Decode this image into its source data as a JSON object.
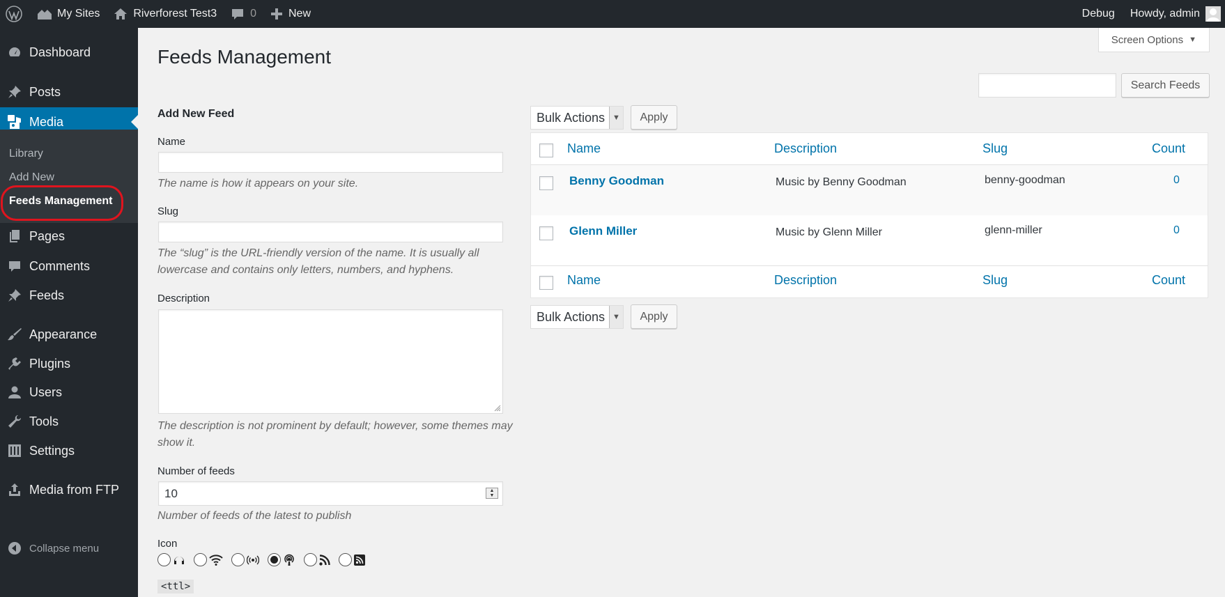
{
  "admin_bar": {
    "my_sites": "My Sites",
    "site_name": "Riverforest Test3",
    "comments_count": "0",
    "new_label": "New",
    "debug": "Debug",
    "howdy": "Howdy, admin"
  },
  "sidebar": {
    "dashboard": "Dashboard",
    "posts": "Posts",
    "media": "Media",
    "submenu": {
      "library": "Library",
      "add_new": "Add New",
      "feeds_management": "Feeds Management"
    },
    "pages": "Pages",
    "comments": "Comments",
    "feeds": "Feeds",
    "appearance": "Appearance",
    "plugins": "Plugins",
    "users": "Users",
    "tools": "Tools",
    "settings": "Settings",
    "media_from_ftp": "Media from FTP",
    "collapse": "Collapse menu"
  },
  "page": {
    "screen_options": "Screen Options",
    "title": "Feeds Management",
    "search_button": "Search Feeds",
    "search_value": ""
  },
  "form": {
    "heading": "Add New Feed",
    "name_label": "Name",
    "name_value": "",
    "name_desc": "The name is how it appears on your site.",
    "slug_label": "Slug",
    "slug_value": "",
    "slug_desc_1": "The “slug” is the URL-friendly version of the name. It is usually all",
    "slug_desc_2": "lowercase and contains only letters, numbers, and hyphens.",
    "description_label": "Description",
    "description_value": "",
    "description_desc_1": "The description is not prominent by default; however, some themes may",
    "description_desc_2": "show it.",
    "number_label": "Number of feeds",
    "number_value": "10",
    "number_desc": "Number of feeds of the latest to publish",
    "icon_label": "Icon",
    "icon_options": [
      "headphones-icon",
      "wifi-icon",
      "broadcast-icon",
      "podcast-icon",
      "rss-icon",
      "rss-square-icon"
    ],
    "icon_selected": "podcast-icon",
    "code_chip": "<ttl>"
  },
  "table": {
    "bulk_actions": "Bulk Actions",
    "apply": "Apply",
    "headers": {
      "name": "Name",
      "description": "Description",
      "slug": "Slug",
      "count": "Count"
    },
    "rows": [
      {
        "name": "Benny Goodman",
        "description": "Music by Benny Goodman",
        "slug": "benny-goodman",
        "count": "0"
      },
      {
        "name": "Glenn Miller",
        "description": "Music by Glenn Miller",
        "slug": "glenn-miller",
        "count": "0"
      }
    ]
  },
  "colors": {
    "admin_dark": "#23282d",
    "accent": "#0073aa",
    "highlight": "#e0141e"
  }
}
